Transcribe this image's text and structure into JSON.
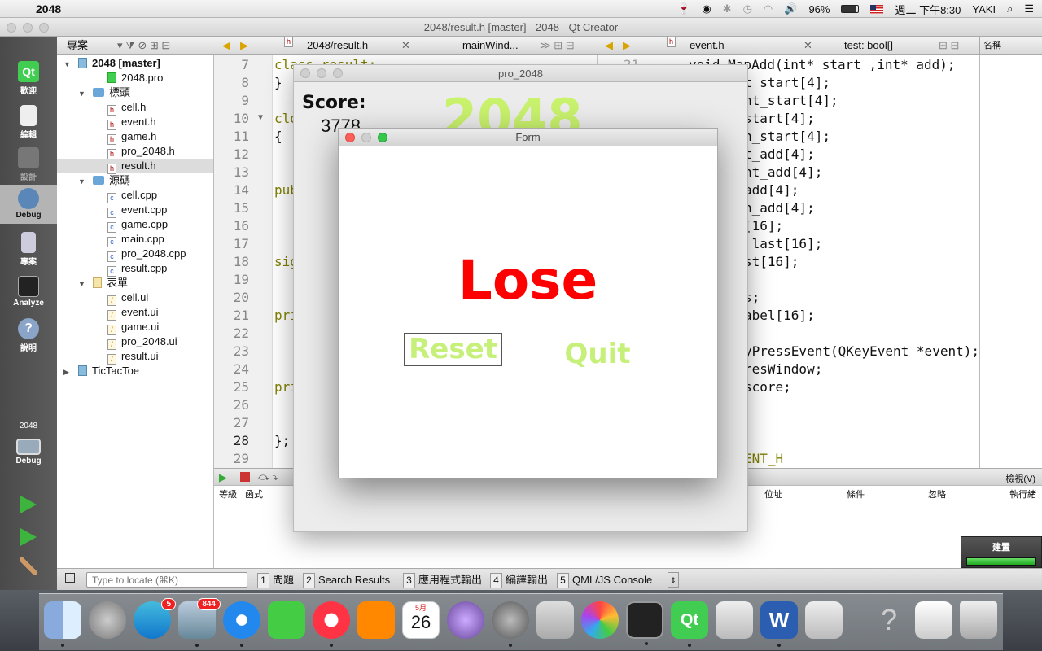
{
  "menubar": {
    "app_name": "2048",
    "battery": "96%",
    "clock": "週二 下午8:30",
    "user": "YAKI"
  },
  "window_title": "2048/result.h [master] - 2048 - Qt Creator",
  "modes": [
    {
      "label": "歡迎"
    },
    {
      "label": "編輯"
    },
    {
      "label": "設計"
    },
    {
      "label": "Debug"
    },
    {
      "label": "專案"
    },
    {
      "label": "Analyze"
    },
    {
      "label": "說明"
    }
  ],
  "kit": {
    "project": "2048",
    "mode": "Debug"
  },
  "project_panel": {
    "title": "專案",
    "tree": [
      {
        "label": "2048 [master]",
        "icon": "qt-project-icon"
      },
      {
        "label": "2048.pro",
        "icon": "pro-file-icon"
      },
      {
        "label": "標頭",
        "icon": "folder-icon"
      },
      {
        "label": "cell.h",
        "icon": "header-file-icon"
      },
      {
        "label": "event.h",
        "icon": "header-file-icon"
      },
      {
        "label": "game.h",
        "icon": "header-file-icon"
      },
      {
        "label": "pro_2048.h",
        "icon": "header-file-icon"
      },
      {
        "label": "result.h",
        "icon": "header-file-icon"
      },
      {
        "label": "源碼",
        "icon": "folder-icon"
      },
      {
        "label": "cell.cpp",
        "icon": "cpp-file-icon"
      },
      {
        "label": "event.cpp",
        "icon": "cpp-file-icon"
      },
      {
        "label": "game.cpp",
        "icon": "cpp-file-icon"
      },
      {
        "label": "main.cpp",
        "icon": "cpp-file-icon"
      },
      {
        "label": "pro_2048.cpp",
        "icon": "cpp-file-icon"
      },
      {
        "label": "result.cpp",
        "icon": "cpp-file-icon"
      },
      {
        "label": "表單",
        "icon": "folder-icon"
      },
      {
        "label": "cell.ui",
        "icon": "ui-file-icon"
      },
      {
        "label": "event.ui",
        "icon": "ui-file-icon"
      },
      {
        "label": "game.ui",
        "icon": "ui-file-icon"
      },
      {
        "label": "pro_2048.ui",
        "icon": "ui-file-icon"
      },
      {
        "label": "result.ui",
        "icon": "ui-file-icon"
      },
      {
        "label": "TicTacToe",
        "icon": "qt-project-icon"
      }
    ]
  },
  "editor_left": {
    "file": "2048/result.h",
    "symbol": "mainWind...",
    "line_numbers": [
      "7",
      "8",
      "9",
      "10",
      "11",
      "12",
      "13",
      "14",
      "15",
      "16",
      "17",
      "18",
      "19",
      "20",
      "21",
      "22",
      "23",
      "24",
      "25",
      "26",
      "27",
      "28",
      "29"
    ],
    "lines": {
      "l7": "class result;",
      "l8": "}",
      "l10": "clo",
      "l11": "{",
      "l14": "pub",
      "l18": "sig",
      "l21": "pri",
      "l25": "pri",
      "l28": "};"
    }
  },
  "editor_right": {
    "file": "event.h",
    "symbol": "test: bool[]",
    "line_number_top": "21",
    "lines": [
      "void MapAdd(int* start ,int* add);",
      "t_start[4];",
      "nt_start[4];",
      "start[4];",
      "n_start[4];",
      "t_add[4];",
      "nt_add[4];",
      "add[4];",
      "n_add[4];",
      "[16];",
      "_last[16];",
      "st[16];",
      "",
      "s;",
      "abel[16];",
      "",
      "yPressEvent(QKeyEvent *event);",
      "resWindow;",
      "score;",
      "",
      "",
      "ENT_H"
    ]
  },
  "names_panel": {
    "title": "名稱"
  },
  "breakpoints": {
    "columns_left": [
      "等級",
      "函式"
    ],
    "columns_right": [
      "位址",
      "條件",
      "忽略",
      "執行緒"
    ],
    "view_label": "檢視(V)"
  },
  "statusbar": {
    "locate_placeholder": "Type to locate (⌘K)",
    "tabs": [
      {
        "num": "1",
        "label": "問題"
      },
      {
        "num": "2",
        "label": "Search Results"
      },
      {
        "num": "3",
        "label": "應用程式輸出"
      },
      {
        "num": "4",
        "label": "編譯輸出"
      },
      {
        "num": "5",
        "label": "QML/JS Console"
      }
    ]
  },
  "build": {
    "label": "建置",
    "progress": 1.0
  },
  "game_window": {
    "title": "pro_2048",
    "score_label": "Score:",
    "score_value": "3778",
    "logo": "2048"
  },
  "form_window": {
    "title": "Form",
    "result_text": "Lose",
    "reset_label": "Reset",
    "quit_label": "Quit"
  },
  "dock": {
    "appstore_badge": "5",
    "mail_badge": "844",
    "calendar_month": "5月",
    "calendar_day": "26"
  },
  "colors": {
    "lose_red": "#ff0000",
    "button_green": "#c6f07a",
    "logo_green": "#c9f26d"
  }
}
